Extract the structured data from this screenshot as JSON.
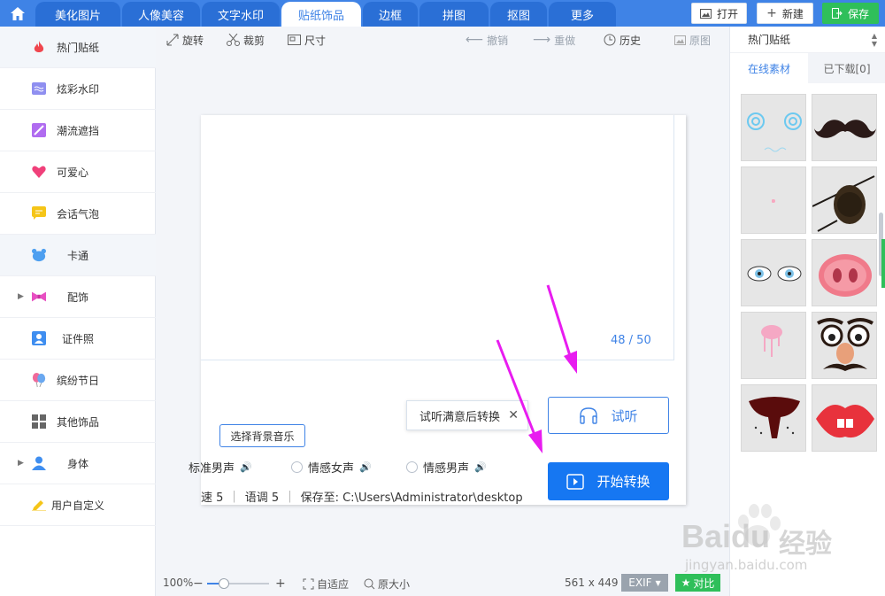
{
  "topbar": {
    "tabs": [
      {
        "label": "美化图片"
      },
      {
        "label": "人像美容"
      },
      {
        "label": "文字水印"
      },
      {
        "label": "贴纸饰品"
      },
      {
        "label": "边框"
      },
      {
        "label": "拼图"
      },
      {
        "label": "抠图"
      },
      {
        "label": "更多"
      }
    ],
    "active_tab": "贴纸饰品",
    "open_label": "打开",
    "new_label": "新建",
    "save_label": "保存"
  },
  "sidebar": {
    "items": [
      {
        "label": "热门贴纸",
        "icon": "flame-icon"
      },
      {
        "label": "炫彩水印",
        "icon": "wave-icon"
      },
      {
        "label": "潮流遮挡",
        "icon": "slash-icon"
      },
      {
        "label": "可爱心",
        "icon": "heart-icon"
      },
      {
        "label": "会话气泡",
        "icon": "speech-bubble-icon"
      },
      {
        "label": "卡通",
        "icon": "bear-icon"
      },
      {
        "label": "配饰",
        "icon": "bow-icon"
      },
      {
        "label": "证件照",
        "icon": "id-photo-icon"
      },
      {
        "label": "缤纷节日",
        "icon": "balloon-icon"
      },
      {
        "label": "其他饰品",
        "icon": "grid-icon"
      },
      {
        "label": "身体",
        "icon": "person-icon"
      },
      {
        "label": "用户自定义",
        "icon": "pencil-icon"
      }
    ]
  },
  "toolbar": {
    "rotate": "旋转",
    "crop": "裁剪",
    "size": "尺寸",
    "undo": "撤销",
    "redo": "重做",
    "history": "历史",
    "original": "原图"
  },
  "dialog": {
    "counter": "48 / 50",
    "tip": "试听满意后转换",
    "listen_label": "试听",
    "start_label": "开始转换",
    "bg_music_label": "选择背景音乐",
    "voices": [
      {
        "label": "标准男声"
      },
      {
        "label": "情感女声"
      },
      {
        "label": "情感男声"
      }
    ],
    "speed": "速 5",
    "pitch": "语调 5",
    "save_to": "保存至: C:\\Users\\Administrator\\desktop"
  },
  "statusbar": {
    "zoom": "100%",
    "fit": "自适应",
    "actual": "原大小",
    "dimensions": "561 x 449",
    "exif": "EXIF",
    "compare": "对比"
  },
  "right_panel": {
    "category": "热门贴纸",
    "tabs": [
      {
        "label": "在线素材"
      },
      {
        "label": "已下载[0]"
      }
    ],
    "active_tab": "在线素材",
    "stickers": [
      {
        "icon": "swirl-eyes-sticker"
      },
      {
        "icon": "mustache-sticker"
      },
      {
        "icon": "blush-sticker"
      },
      {
        "icon": "eyepatch-sticker"
      },
      {
        "icon": "cartoon-eyes-sticker"
      },
      {
        "icon": "pig-nose-sticker"
      },
      {
        "icon": "drool-sticker"
      },
      {
        "icon": "disguise-glasses-sticker"
      },
      {
        "icon": "vampire-mouth-sticker"
      },
      {
        "icon": "funny-lips-sticker"
      }
    ]
  },
  "watermark": {
    "brand": "Baidu",
    "brand_cn": "经验",
    "url": "jingyan.baidu.com"
  },
  "colors": {
    "accent": "#3f83e6",
    "primary_button": "#1677f2",
    "save_green": "#2fbf5a",
    "annotation_arrow": "#e81cf0"
  }
}
